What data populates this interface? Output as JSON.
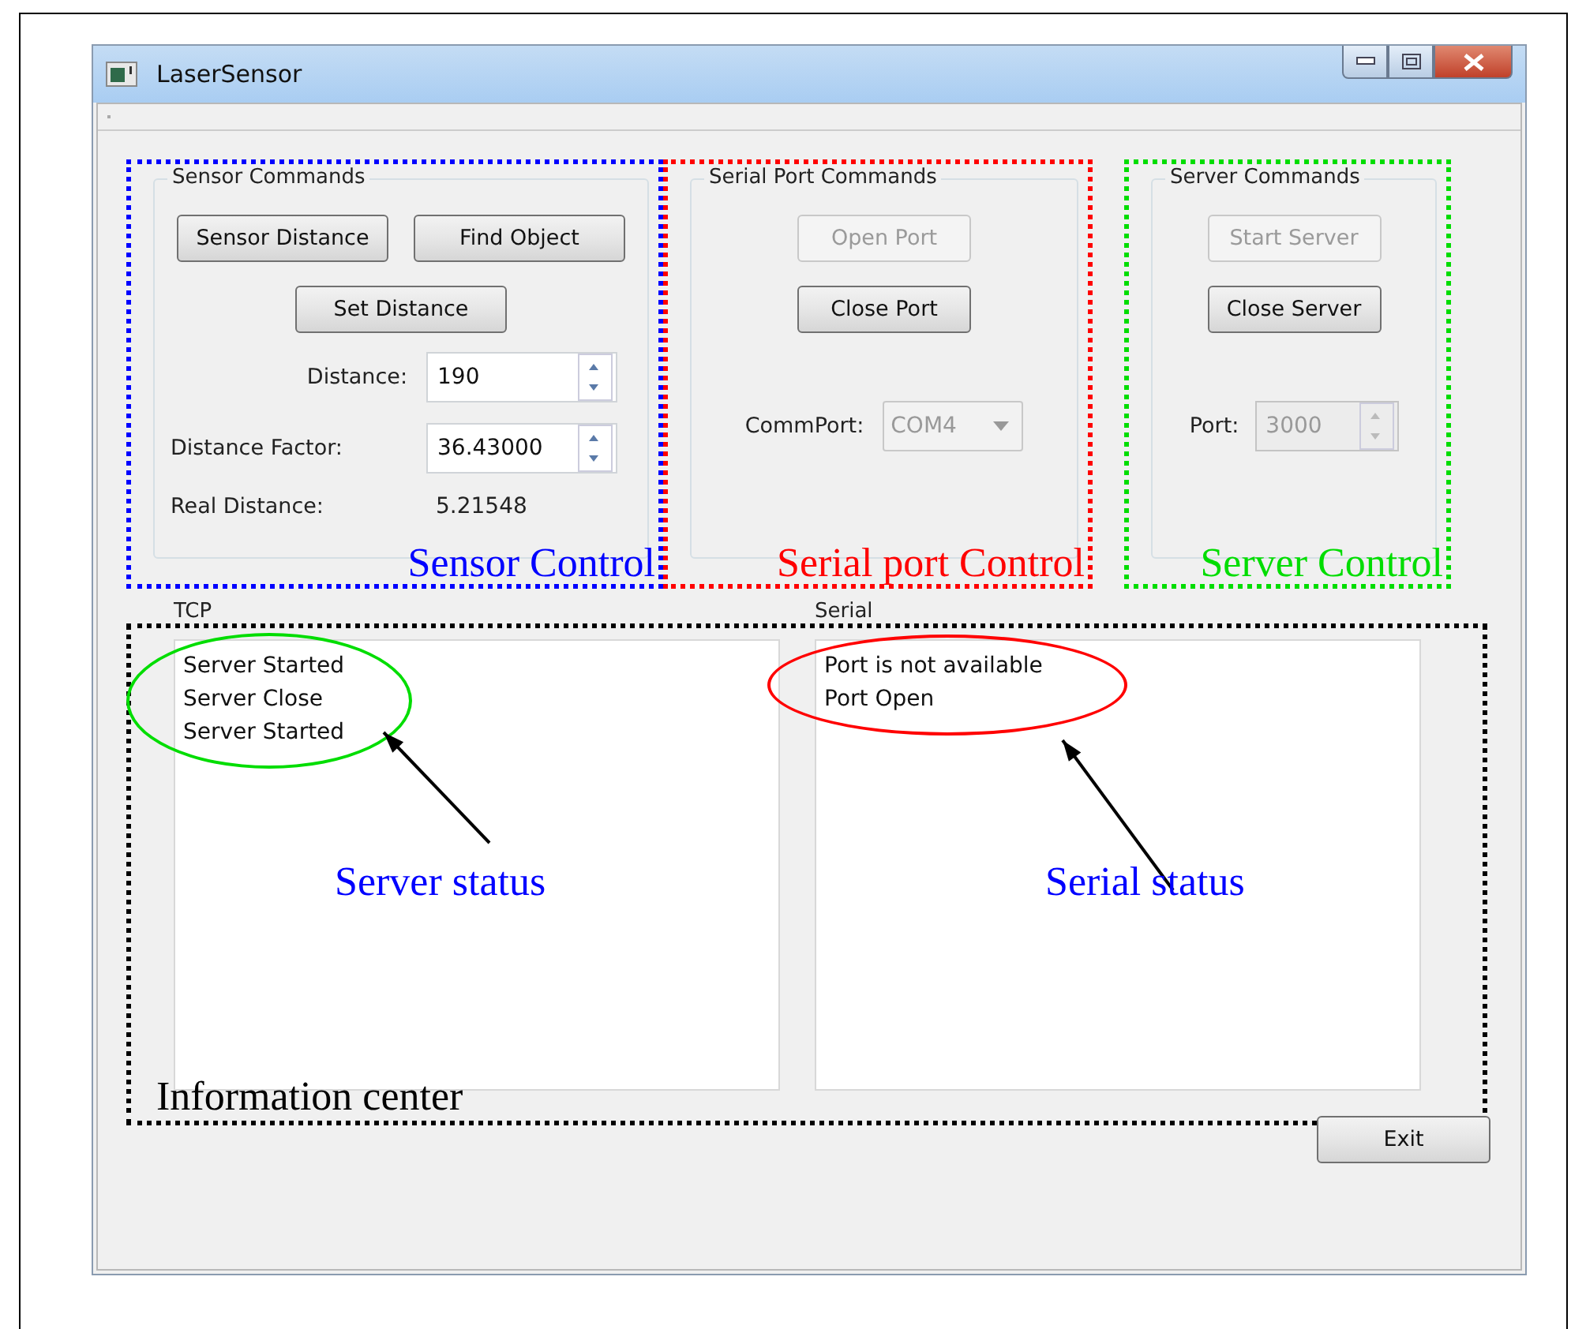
{
  "window": {
    "title": "LaserSensor"
  },
  "groups": [
    {
      "kind": "sensor",
      "title": "Sensor Commands",
      "annotation": {
        "text": "Sensor Control",
        "color": "#0000ff"
      },
      "buttons": [
        {
          "label": "Sensor Distance",
          "disabled": false
        },
        {
          "label": "Find Object",
          "disabled": false
        },
        {
          "label": "Set Distance",
          "disabled": false
        }
      ],
      "fields": [
        {
          "kind": "spin",
          "label": "Distance:",
          "value": "190",
          "disabled": false
        },
        {
          "kind": "spin",
          "label": "Distance Factor:",
          "value": "36.43000",
          "disabled": false
        },
        {
          "kind": "readout",
          "label": "Real Distance:",
          "value": "5.21548"
        }
      ]
    },
    {
      "kind": "serial",
      "title": "Serial Port Commands",
      "annotation": {
        "text": "Serial port Control",
        "color": "#ff0000"
      },
      "buttons": [
        {
          "label": "Open Port",
          "disabled": true
        },
        {
          "label": "Close Port",
          "disabled": false
        }
      ],
      "fields": [
        {
          "kind": "combo",
          "label": "CommPort:",
          "value": "COM4",
          "disabled": true
        }
      ]
    },
    {
      "kind": "server",
      "title": "Server Commands",
      "annotation": {
        "text": "Server Control",
        "color": "#00dd00"
      },
      "buttons": [
        {
          "label": "Start Server",
          "disabled": true
        },
        {
          "label": "Close Server",
          "disabled": false
        }
      ],
      "fields": [
        {
          "kind": "spin",
          "label": "Port:",
          "value": "3000",
          "disabled": true
        }
      ]
    }
  ],
  "info_center": {
    "annotation": {
      "text": "Information center",
      "color": "#000000"
    },
    "panes": [
      {
        "label": "TCP",
        "lines": [
          "Server Started",
          "Server Close",
          "Server Started"
        ],
        "ring": {
          "color": "#00dd00"
        },
        "callout": {
          "text": "Server status",
          "color": "#0000ff"
        }
      },
      {
        "label": "Serial",
        "lines": [
          "Port is not available",
          "Port Open"
        ],
        "ring": {
          "color": "#ff0000"
        },
        "callout": {
          "text": "Serial status",
          "color": "#0000ff"
        }
      }
    ]
  },
  "exit_button": {
    "label": "Exit"
  }
}
